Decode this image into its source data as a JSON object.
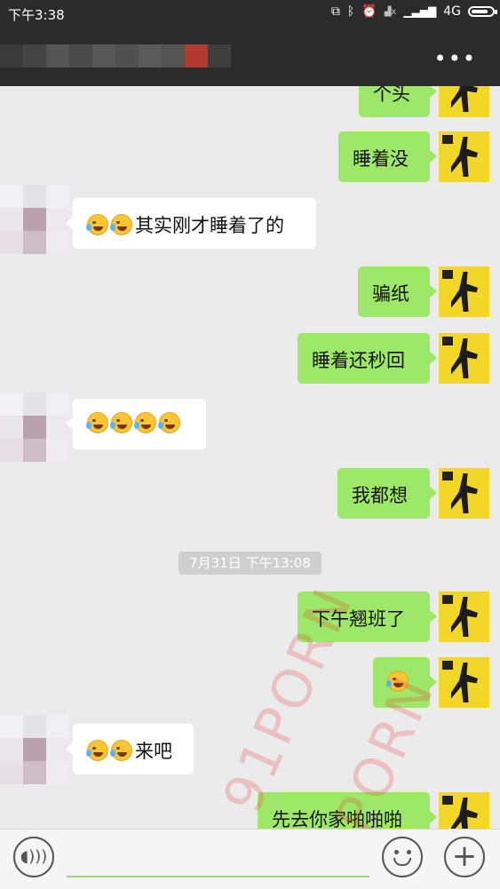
{
  "status_bar": {
    "time": "下午3:38",
    "network": "4G",
    "icons": [
      "copy-icon",
      "bluetooth-icon",
      "alarm-icon",
      "wifi-off-icon",
      "signal-icon",
      "signal-icon",
      "battery-icon"
    ]
  },
  "header": {
    "contact_name_obscured": true,
    "menu_label": "•••"
  },
  "messages": [
    {
      "side": "right",
      "text": "个头"
    },
    {
      "side": "right",
      "text": "睡着没"
    },
    {
      "side": "left",
      "emojis": 2,
      "text": "其实刚才睡着了的"
    },
    {
      "side": "right",
      "text": "骗纸"
    },
    {
      "side": "right",
      "text": "睡着还秒回"
    },
    {
      "side": "left",
      "emojis": 4,
      "text": ""
    },
    {
      "side": "right",
      "text": "我都想"
    },
    {
      "side": "right",
      "text": "下午翘班了"
    },
    {
      "side": "right",
      "emojis": 1,
      "text": ""
    },
    {
      "side": "left",
      "emojis": 2,
      "text": "来吧"
    },
    {
      "side": "right",
      "text": "先去你家啪啪啪"
    }
  ],
  "timestamp": "7月31日 下午13:08",
  "watermark": "91PORN",
  "input_bar": {
    "voice_icon": "voice-icon",
    "emoji_icon": "emoji-icon",
    "plus_icon": "plus-icon"
  },
  "colors": {
    "bar_background": "#2b2b2b",
    "chat_background": "#ebebeb",
    "sent_bubble": "#9de869",
    "received_bubble": "#ffffff",
    "avatar_yellow": "#f3d726"
  }
}
